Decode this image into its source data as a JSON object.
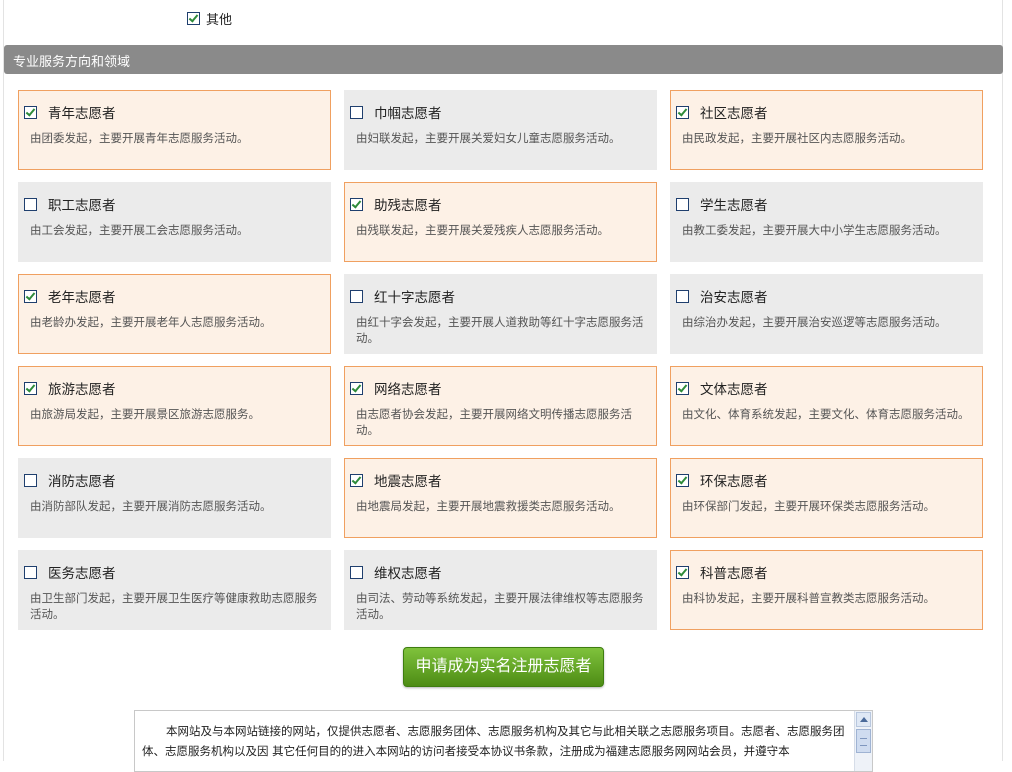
{
  "other_option": {
    "label": "其他",
    "checked": true
  },
  "section_title": "专业服务方向和领域",
  "cards": [
    {
      "title": "青年志愿者",
      "desc": "由团委发起，主要开展青年志愿服务活动。",
      "checked": true
    },
    {
      "title": "巾帼志愿者",
      "desc": "由妇联发起，主要开展关爱妇女儿童志愿服务活动。",
      "checked": false
    },
    {
      "title": "社区志愿者",
      "desc": "由民政发起，主要开展社区内志愿服务活动。",
      "checked": true
    },
    {
      "title": "职工志愿者",
      "desc": "由工会发起，主要开展工会志愿服务活动。",
      "checked": false
    },
    {
      "title": "助残志愿者",
      "desc": "由残联发起，主要开展关爱残疾人志愿服务活动。",
      "checked": true
    },
    {
      "title": "学生志愿者",
      "desc": "由教工委发起，主要开展大中小学生志愿服务活动。",
      "checked": false
    },
    {
      "title": "老年志愿者",
      "desc": "由老龄办发起，主要开展老年人志愿服务活动。",
      "checked": true
    },
    {
      "title": "红十字志愿者",
      "desc": "由红十字会发起，主要开展人道救助等红十字志愿服务活动。",
      "checked": false
    },
    {
      "title": "治安志愿者",
      "desc": "由综治办发起，主要开展治安巡逻等志愿服务活动。",
      "checked": false
    },
    {
      "title": "旅游志愿者",
      "desc": "由旅游局发起，主要开展景区旅游志愿服务。",
      "checked": true
    },
    {
      "title": "网络志愿者",
      "desc": "由志愿者协会发起，主要开展网络文明传播志愿服务活动。",
      "checked": true
    },
    {
      "title": "文体志愿者",
      "desc": "由文化、体育系统发起，主要文化、体育志愿服务活动。",
      "checked": true
    },
    {
      "title": "消防志愿者",
      "desc": "由消防部队发起，主要开展消防志愿服务活动。",
      "checked": false
    },
    {
      "title": "地震志愿者",
      "desc": "由地震局发起，主要开展地震救援类志愿服务活动。",
      "checked": true
    },
    {
      "title": "环保志愿者",
      "desc": "由环保部门发起，主要开展环保类志愿服务活动。",
      "checked": true
    },
    {
      "title": "医务志愿者",
      "desc": "由卫生部门发起，主要开展卫生医疗等健康救助志愿服务活动。",
      "checked": false
    },
    {
      "title": "维权志愿者",
      "desc": "由司法、劳动等系统发起，主要开展法律维权等志愿服务活动。",
      "checked": false
    },
    {
      "title": "科普志愿者",
      "desc": "由科协发起，主要开展科普宣教类志愿服务活动。",
      "checked": true
    }
  ],
  "submit_label": "申请成为实名注册志愿者",
  "agreement_text": "本网站及与本网站链接的网站，仅提供志愿者、志愿服务团体、志愿服务机构及其它与此相关联之志愿服务项目。志愿者、志愿服务团体、志愿服务机构以及因 其它任何目的的进入本网站的访问者接受本协议书条款，注册成为福建志愿服务网网站会员，并遵守本",
  "colors": {
    "section_bar": "#8a8a8a",
    "card_checked_bg": "#fdf1e6",
    "card_checked_border": "#f0a060",
    "card_unchecked_bg": "#ebebeb",
    "button_green": "#5fa322"
  }
}
